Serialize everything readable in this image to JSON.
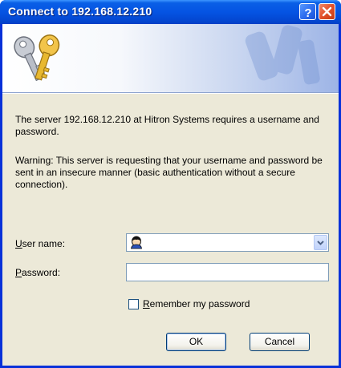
{
  "window": {
    "title": "Connect to 192.168.12.210",
    "help_button": "?",
    "close_button": "X"
  },
  "dialog": {
    "message": "The server 192.168.12.210 at Hitron Systems requires a username and password.",
    "warning": "Warning: This server is requesting that your username and password be sent in an insecure manner (basic authentication without a secure connection).",
    "username_label_accel": "U",
    "username_label_rest": "ser name:",
    "username_value": "",
    "password_label_accel": "P",
    "password_label_rest": "assword:",
    "password_value": "",
    "remember_checked": false,
    "remember_label_accel": "R",
    "remember_label_rest": "emember my password",
    "ok_label": "OK",
    "cancel_label": "Cancel"
  },
  "icons": {
    "banner": "keys-icon",
    "user": "user-icon",
    "dropdown": "chevron-down-icon"
  },
  "colors": {
    "titlebar": "#0554e3",
    "dialog_bg": "#ece9d8",
    "field_border": "#7f9db9"
  }
}
